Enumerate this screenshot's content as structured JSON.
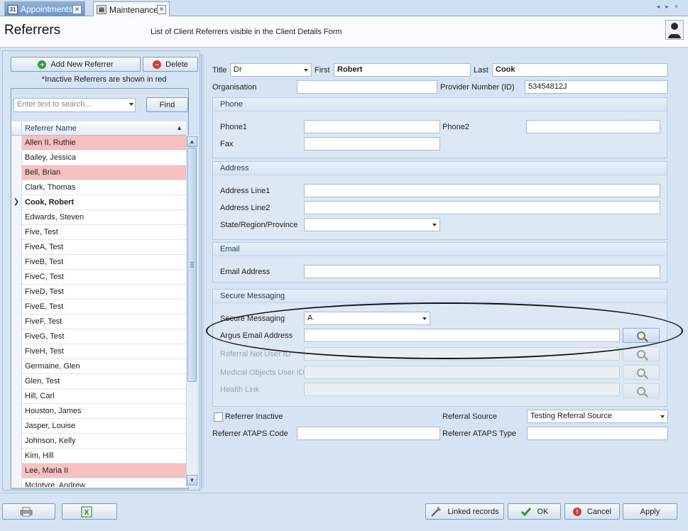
{
  "tabs": [
    {
      "label": "Appointments",
      "icon": "calendar-icon",
      "icon_text": "31"
    },
    {
      "label": "Maintenance",
      "icon": "maintenance-icon"
    }
  ],
  "header": {
    "title": "Referrers",
    "subtitle": "List of Client Referrers visible in the Client Details Form"
  },
  "left": {
    "add_label": "Add New Referrer",
    "delete_label": "Delete",
    "inactive_note": "*Inactive Referrers are shown in red",
    "search_placeholder": "Enter text to search...",
    "find_label": "Find",
    "column_header": "Referrer Name",
    "rows": [
      {
        "name": "Allen II, Ruthie",
        "inactive": true
      },
      {
        "name": "Bailey, Jessica",
        "inactive": false
      },
      {
        "name": "Bell, Brian",
        "inactive": true
      },
      {
        "name": "Clark, Thomas",
        "inactive": false
      },
      {
        "name": "Cook, Robert",
        "inactive": false,
        "selected": true
      },
      {
        "name": "Edwards, Steven",
        "inactive": false
      },
      {
        "name": "Five, Test",
        "inactive": false
      },
      {
        "name": "FiveA, Test",
        "inactive": false
      },
      {
        "name": "FiveB, Test",
        "inactive": false
      },
      {
        "name": "FiveC, Test",
        "inactive": false
      },
      {
        "name": "FiveD, Test",
        "inactive": false
      },
      {
        "name": "FiveE, Test",
        "inactive": false
      },
      {
        "name": "FiveF, Test",
        "inactive": false
      },
      {
        "name": "FiveG, Test",
        "inactive": false
      },
      {
        "name": "FiveH, Test",
        "inactive": false
      },
      {
        "name": "Germaine, Glen",
        "inactive": false
      },
      {
        "name": "Glen, Test",
        "inactive": false
      },
      {
        "name": "Hill, Carl",
        "inactive": false
      },
      {
        "name": "Houston, James",
        "inactive": false
      },
      {
        "name": "Jasper, Louise",
        "inactive": false
      },
      {
        "name": "Johnson, Kelly",
        "inactive": false
      },
      {
        "name": "Kim, Hill",
        "inactive": false
      },
      {
        "name": "Lee, Maria II",
        "inactive": true
      },
      {
        "name": "McIntyre, Andrew",
        "inactive": false
      }
    ]
  },
  "form": {
    "title_label": "Title",
    "title_value": "Dr",
    "first_label": "First",
    "first_value": "Robert",
    "last_label": "Last",
    "last_value": "Cook",
    "organisation_label": "Organisation",
    "organisation_value": "",
    "provider_label": "Provider Number (ID)",
    "provider_value": "53454812J",
    "phone_group": "Phone",
    "phone1_label": "Phone1",
    "phone2_label": "Phone2",
    "fax_label": "Fax",
    "address_group": "Address",
    "address1_label": "Address Line1",
    "address2_label": "Address Line2",
    "state_label": "State/Region/Province",
    "email_group": "Email",
    "email_label": "Email Address",
    "secure_group": "Secure Messaging",
    "secure_label": "Secure Messaging",
    "secure_value": "A",
    "argus_label": "Argus Email Address",
    "rnet_label": "Referral Net User ID",
    "medobj_label": "Medical Objects User ID",
    "healthlink_label": "Health Link",
    "inactive_label": "Referrer Inactive",
    "source_label": "Referral Source",
    "source_value": "Testing Referral Source",
    "ataps_code_label": "Referrer ATAPS Code",
    "ataps_type_label": "Referrer ATAPS Type"
  },
  "bottom": {
    "linked_label": "Linked records",
    "ok_label": "OK",
    "cancel_label": "Cancel",
    "apply_label": "Apply"
  },
  "colors": {
    "inactive_row": "#f7c1c1",
    "panel_bg": "#d5e3f3",
    "accent": "#1f3d6a"
  }
}
